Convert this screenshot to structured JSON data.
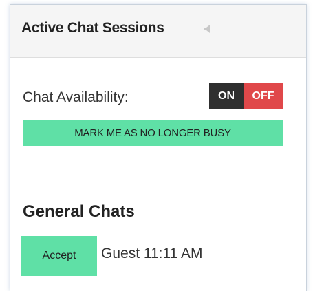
{
  "panel": {
    "title": "Active Chat Sessions",
    "sound_icon": "speaker-icon"
  },
  "availability": {
    "label": "Chat Availability:",
    "on_label": "ON",
    "off_label": "OFF",
    "selected": "OFF",
    "busy_button_label": "MARK ME AS NO LONGER BUSY"
  },
  "general_chats": {
    "title": "General Chats",
    "items": [
      {
        "accept_label": "Accept",
        "guest": "Guest 11:11 AM"
      }
    ]
  },
  "colors": {
    "toggle_on_bg": "#2f2f2f",
    "toggle_off_bg": "#e0484a",
    "accent_green": "#5fe0a6",
    "header_bg": "#f5f5f5"
  }
}
